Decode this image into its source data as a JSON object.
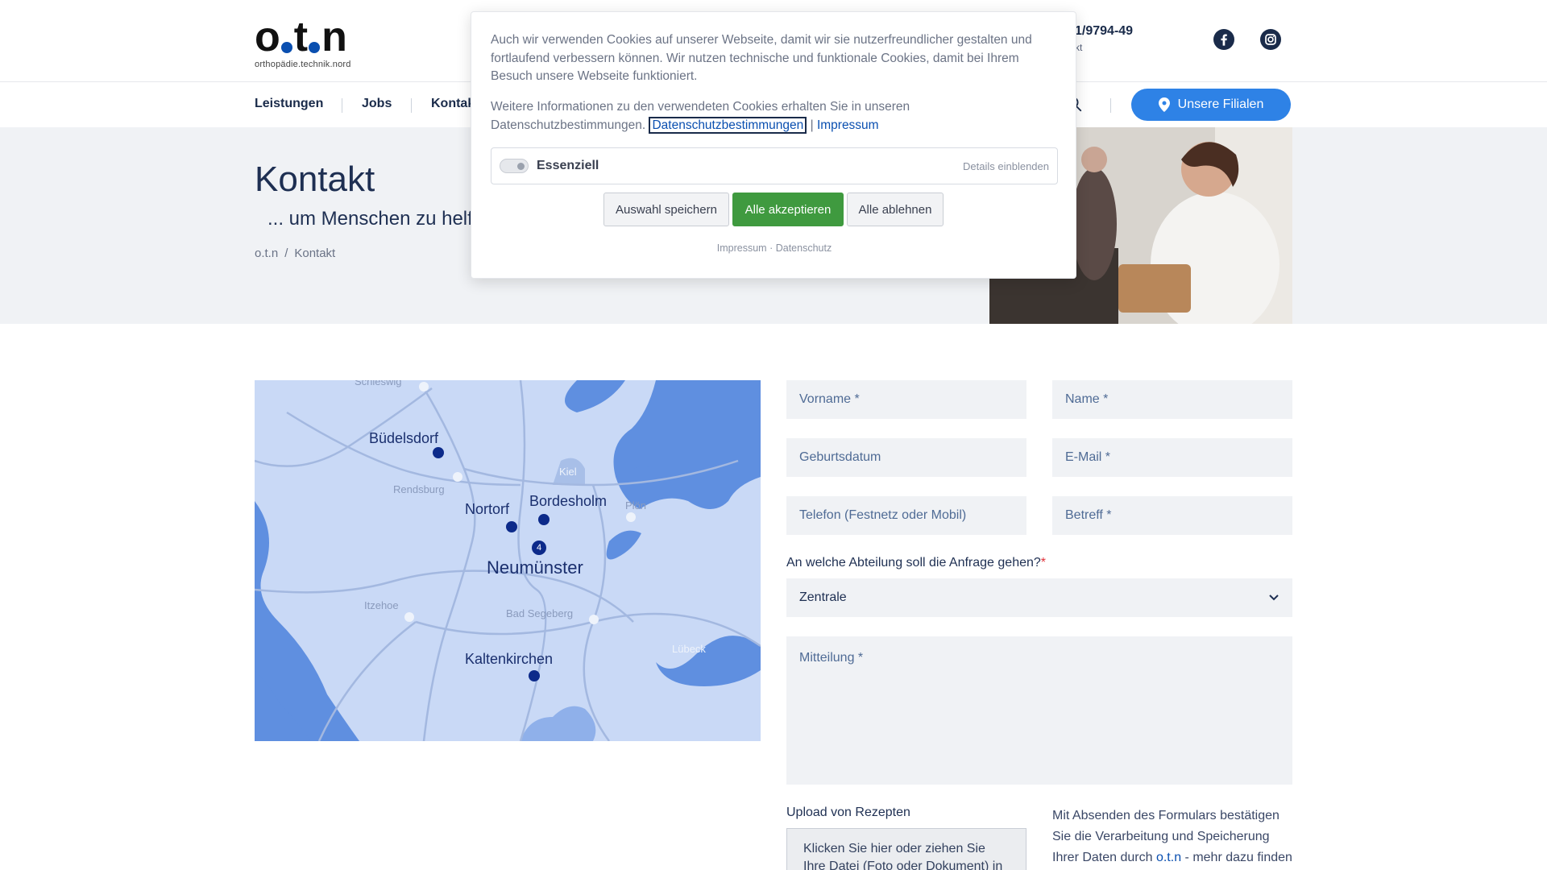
{
  "header": {
    "logo_text": "o.t.n",
    "logo_sub": "orthopädie.technik.nord",
    "phone": "1/9794-49",
    "phone_sub": "kt",
    "nav": [
      {
        "label": "Leistungen"
      },
      {
        "label": "Jobs"
      },
      {
        "label": "Kontakt"
      }
    ],
    "filialen_label": "Unsere Filialen",
    "icons": {
      "facebook": "facebook-icon",
      "instagram": "instagram-icon",
      "search": "search-icon",
      "pin": "map-pin-icon"
    },
    "accent_color": "#2e82e6"
  },
  "hero": {
    "title": "Kontakt",
    "subtitle": "... um Menschen zu helf",
    "breadcrumb": [
      "o.t.n",
      "/",
      "Kontakt"
    ]
  },
  "map": {
    "labels": {
      "schleswig": "Schleswig",
      "buedelsdorf": "Büdelsdorf",
      "rendsburg": "Rendsburg",
      "kiel": "Kiel",
      "nortorf": "Nortorf",
      "bordesholm": "Bordesholm",
      "ploen": "Plön",
      "neumuenster": "Neumünster",
      "itzehoe": "Itzehoe",
      "bad_segeberg": "Bad Segeberg",
      "luebeck": "Lübeck",
      "kaltenkirchen": "Kaltenkirchen"
    },
    "badge": "4"
  },
  "form": {
    "vorname": "Vorname *",
    "name": "Name *",
    "geburtsdatum": "Geburtsdatum",
    "email": "E-Mail *",
    "telefon": "Telefon (Festnetz oder Mobil)",
    "betreff": "Betreff *",
    "question": "An welche Abteilung soll die Anfrage gehen?",
    "question_req": "*",
    "department": "Zentrale",
    "mitteilung": "Mitteilung *",
    "upload_label": "Upload von Rezepten",
    "upload_box": "Klicken Sie hier oder ziehen Sie Ihre Datei (Foto oder Dokument) in",
    "consent_before": "Mit Absenden des Formulars bestätigen Sie die Verarbeitung und Speicherung Ihrer Daten durch ",
    "consent_brand": "o.t.n",
    "consent_after": " - mehr dazu finden"
  },
  "cookie": {
    "text1": "Auch wir verwenden Cookies auf unserer Webseite, damit wir sie nutzerfreundlicher gestalten und fortlaufend verbessern können. Wir nutzen technische und funktionale Cookies, damit bei Ihrem Besuch unsere Webseite funktioniert.",
    "text2_before": "Weitere Informationen zu den verwendeten Cookies erhalten Sie in unseren Datenschutzbestimmungen.",
    "link_datenschutz": "Datenschutzbestimmungen",
    "pipe": "|",
    "link_impressum": "Impressum",
    "essential_label": "Essenziell",
    "details": "Details einblenden",
    "btn_save": "Auswahl speichern",
    "btn_accept": "Alle akzeptieren",
    "btn_reject": "Alle ablehnen",
    "footer_impressum": "Impressum",
    "footer_sep": "·",
    "footer_datenschutz": "Datenschutz",
    "accept_color": "#3f9a3f"
  }
}
